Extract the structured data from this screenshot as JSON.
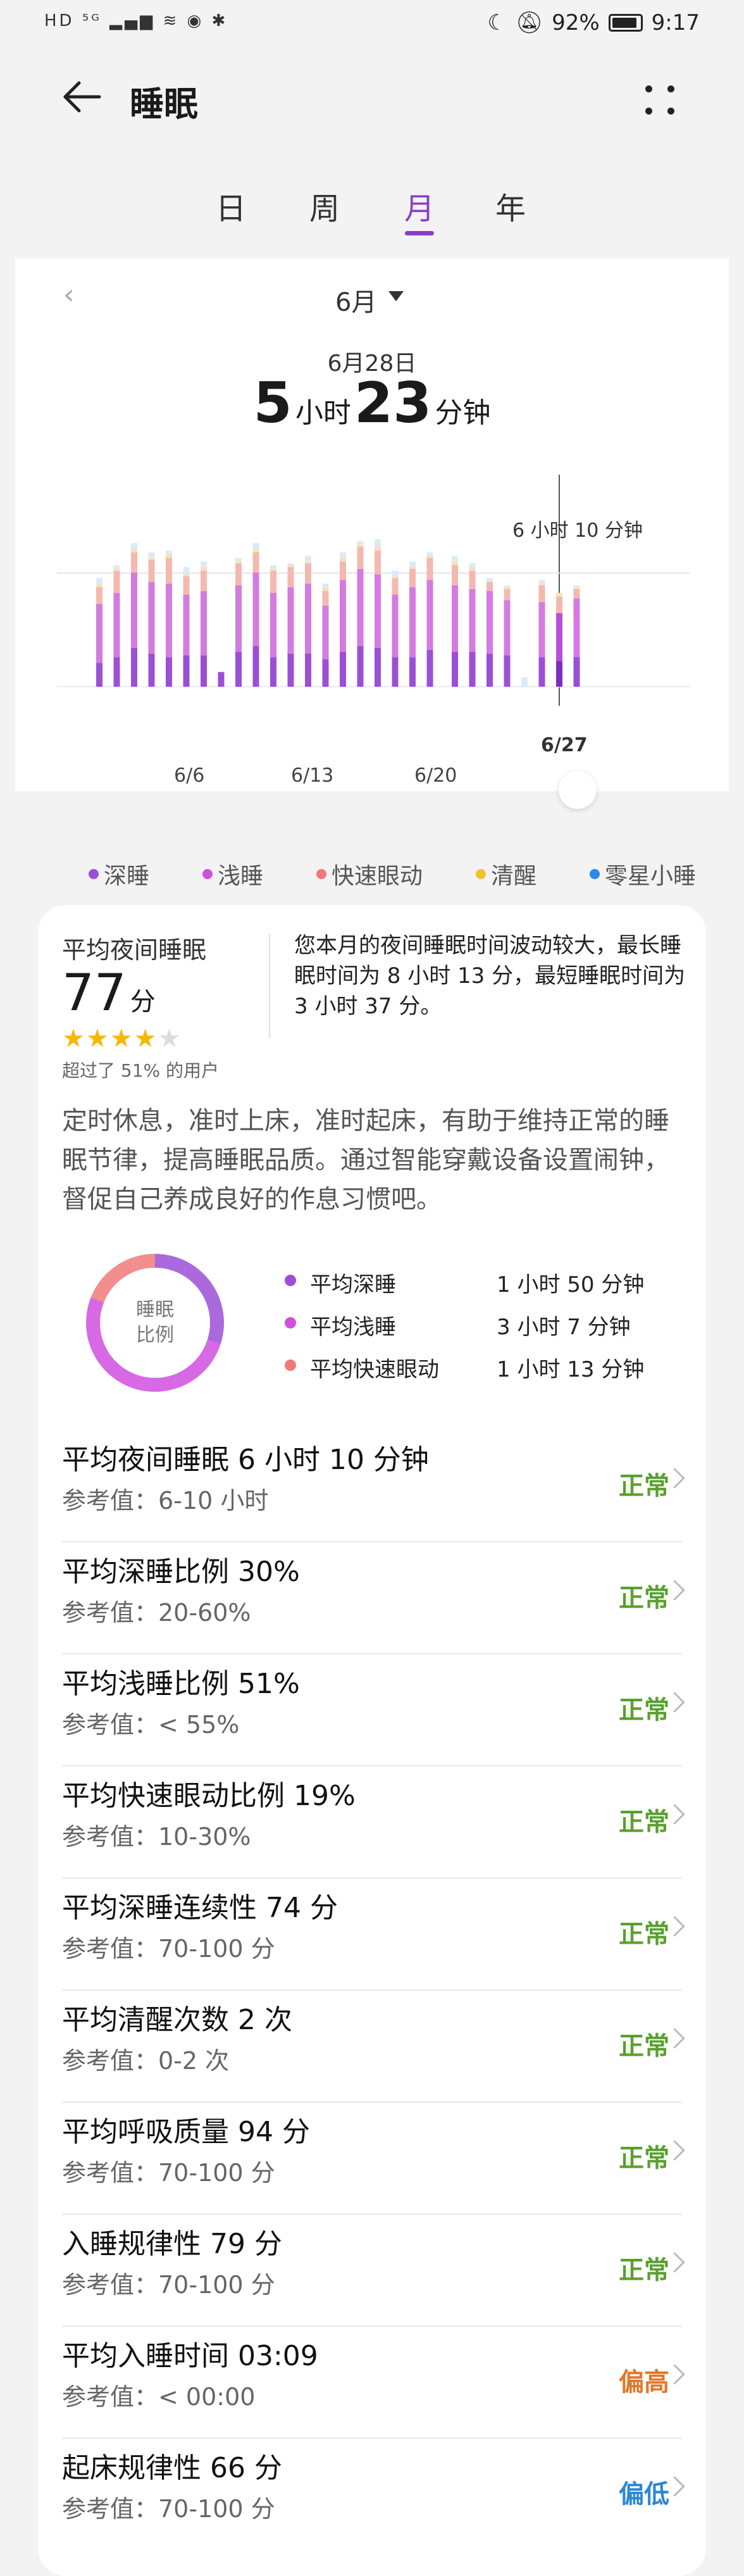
{
  "status_bar": {
    "left": "HD ⁵ᴳ ▂▄▆ ≋ ◉ ✱",
    "battery": "92%",
    "time": "9:17"
  },
  "header": {
    "title": "睡眠"
  },
  "tabs": [
    {
      "label": "日"
    },
    {
      "label": "周"
    },
    {
      "label": "月",
      "active": true
    },
    {
      "label": "年"
    }
  ],
  "chart_header": {
    "month": "6月",
    "selected_date": "6月28日",
    "hours": "5",
    "hours_unit": "小时",
    "minutes": "23",
    "minutes_unit": "分钟"
  },
  "chart_data": {
    "type": "bar",
    "title": "",
    "reference_line_label": "6 小时 10 分钟",
    "reference_value_hours": 6.17,
    "selected_day": "6/27",
    "x_tick_labels": [
      "6/6",
      "6/13",
      "6/20"
    ],
    "categories": [
      "6/1",
      "6/2",
      "6/3",
      "6/4",
      "6/5",
      "6/6",
      "6/7",
      "6/8",
      "6/9",
      "6/10",
      "6/11",
      "6/12",
      "6/13",
      "6/14",
      "6/15",
      "6/16",
      "6/17",
      "6/18",
      "6/19",
      "6/20",
      "6/21",
      "6/22",
      "6/23",
      "6/24",
      "6/25",
      "6/26",
      "6/27",
      "6/28"
    ],
    "series": [
      {
        "name": "深睡",
        "color": "#9b4fd6",
        "values": [
          1.3,
          1.6,
          2.1,
          1.8,
          1.6,
          1.7,
          1.7,
          0.8,
          1.9,
          2.2,
          1.6,
          1.8,
          1.8,
          1.5,
          1.9,
          2.2,
          2.1,
          1.6,
          1.6,
          2.0,
          1.9,
          1.9,
          1.8,
          1.7,
          0,
          1.6,
          1.4,
          1.6
        ]
      },
      {
        "name": "浅睡",
        "color": "#d47be0",
        "values": [
          3.2,
          3.5,
          4.1,
          3.9,
          4.0,
          3.3,
          3.5,
          0,
          3.6,
          4.0,
          3.5,
          3.6,
          3.8,
          2.9,
          3.9,
          4.2,
          4.0,
          3.4,
          3.8,
          3.8,
          3.6,
          3.4,
          3.4,
          3.0,
          0,
          3.0,
          2.6,
          3.2
        ]
      },
      {
        "name": "快速眼动",
        "color": "#f3b9b0",
        "values": [
          0.9,
          1.2,
          1.1,
          1.2,
          1.4,
          1.0,
          1.1,
          0,
          1.2,
          1.1,
          1.2,
          1.1,
          1.1,
          0.8,
          1.0,
          1.2,
          1.3,
          0.9,
          1.0,
          1.2,
          1.1,
          1.0,
          0.5,
          0.6,
          0,
          0.9,
          0.9,
          0.5
        ]
      },
      {
        "name": "清醒",
        "color": "#fae0b8",
        "values": [
          0.2,
          0.1,
          0.2,
          0.1,
          0.2,
          0.1,
          0.2,
          0,
          0.1,
          0.2,
          0.1,
          0.1,
          0.1,
          0.2,
          0.2,
          0.1,
          0.2,
          0.1,
          0.1,
          0.1,
          0.2,
          0.2,
          0,
          0.1,
          0,
          0.1,
          0.2,
          0.1
        ]
      },
      {
        "name": "零星小睡",
        "color": "#d9ebf9",
        "values": [
          0.3,
          0.2,
          0.3,
          0.3,
          0.2,
          0.4,
          0.3,
          0,
          0.2,
          0.3,
          0.2,
          0.1,
          0.3,
          0.2,
          0.3,
          0.2,
          0.4,
          0.3,
          0.3,
          0.2,
          0.3,
          0.2,
          0.2,
          0.1,
          0.5,
          0.2,
          0,
          0.1
        ]
      }
    ],
    "ylim": [
      0,
      11
    ]
  },
  "legend": [
    {
      "label": "深睡",
      "color": "#9b4fd6"
    },
    {
      "label": "浅睡",
      "color": "#d04fe0"
    },
    {
      "label": "快速眼动",
      "color": "#f07a7a"
    },
    {
      "label": "清醒",
      "color": "#f5c030"
    },
    {
      "label": "零星小睡",
      "color": "#2a8ae8"
    }
  ],
  "summary": {
    "title": "平均夜间睡眠",
    "score": "77",
    "score_unit": "分",
    "stars_filled": 4,
    "stars_total": 5,
    "beat": "超过了 51% 的用户",
    "comment": "您本月的夜间睡眠时间波动较大，最长睡眠时间为 8 小时 13 分，最短睡眠时间为 3 小时 37 分。",
    "advice": "定时休息，准时上床，准时起床，有助于维持正常的睡眠节律，提高睡眠品质。通过智能穿戴设备设置闹钟，督促自己养成良好的作息习惯吧。",
    "donut_label_1": "睡眠",
    "donut_label_2": "比例",
    "ratios": [
      {
        "name": "平均深睡",
        "value": "1 小时 50 分钟",
        "color": "#9b4fd6",
        "fraction": 0.3
      },
      {
        "name": "平均浅睡",
        "value": "3 小时 7 分钟",
        "color": "#d04fe0",
        "fraction": 0.51
      },
      {
        "name": "平均快速眼动",
        "value": "1 小时 13 分钟",
        "color": "#f07a7a",
        "fraction": 0.19
      }
    ]
  },
  "metrics": [
    {
      "name": "平均夜间睡眠  6 小时 10 分钟",
      "ref": "参考值：6-10 小时",
      "status": "正常",
      "status_color": "#5aa02c"
    },
    {
      "name": "平均深睡比例  30%",
      "ref": "参考值：20-60%",
      "status": "正常",
      "status_color": "#5aa02c"
    },
    {
      "name": "平均浅睡比例  51%",
      "ref": "参考值：< 55%",
      "status": "正常",
      "status_color": "#5aa02c"
    },
    {
      "name": "平均快速眼动比例  19%",
      "ref": "参考值：10-30%",
      "status": "正常",
      "status_color": "#5aa02c"
    },
    {
      "name": "平均深睡连续性  74 分",
      "ref": "参考值：70-100 分",
      "status": "正常",
      "status_color": "#5aa02c"
    },
    {
      "name": "平均清醒次数  2 次",
      "ref": "参考值：0-2 次",
      "status": "正常",
      "status_color": "#5aa02c"
    },
    {
      "name": "平均呼吸质量  94 分",
      "ref": "参考值：70-100 分",
      "status": "正常",
      "status_color": "#5aa02c"
    },
    {
      "name": "入睡规律性  79 分",
      "ref": "参考值：70-100 分",
      "status": "正常",
      "status_color": "#5aa02c"
    },
    {
      "name": "平均入睡时间  03:09",
      "ref": "参考值：< 00:00",
      "status": "偏高",
      "status_color": "#e0782a"
    },
    {
      "name": "起床规律性  66 分",
      "ref": "参考值：70-100 分",
      "status": "偏低",
      "status_color": "#2a86d8"
    }
  ]
}
